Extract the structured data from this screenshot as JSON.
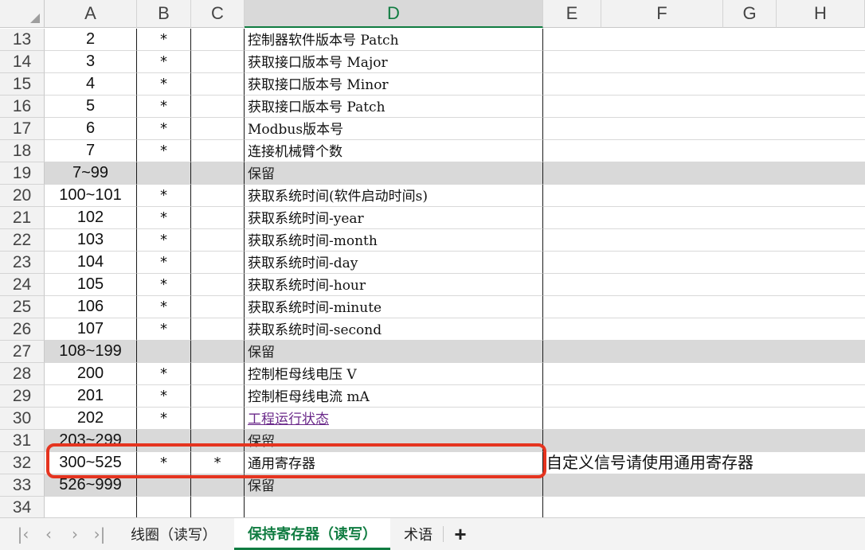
{
  "columns": [
    "A",
    "B",
    "C",
    "D",
    "E",
    "F",
    "G",
    "H"
  ],
  "active_column": "D",
  "rows": [
    {
      "num": "13",
      "a": "2",
      "b": "*",
      "c": "",
      "d": "控制器软件版本号 Patch",
      "e": "",
      "gray": false
    },
    {
      "num": "14",
      "a": "3",
      "b": "*",
      "c": "",
      "d": "获取接口版本号 Major",
      "e": "",
      "gray": false
    },
    {
      "num": "15",
      "a": "4",
      "b": "*",
      "c": "",
      "d": "获取接口版本号 Minor",
      "e": "",
      "gray": false
    },
    {
      "num": "16",
      "a": "5",
      "b": "*",
      "c": "",
      "d": "获取接口版本号 Patch",
      "e": "",
      "gray": false
    },
    {
      "num": "17",
      "a": "6",
      "b": "*",
      "c": "",
      "d": "Modbus版本号",
      "e": "",
      "gray": false
    },
    {
      "num": "18",
      "a": "7",
      "b": "*",
      "c": "",
      "d": "连接机械臂个数",
      "e": "",
      "gray": false
    },
    {
      "num": "19",
      "a": "7~99",
      "b": "",
      "c": "",
      "d": "保留",
      "e": "",
      "gray": true
    },
    {
      "num": "20",
      "a": "100~101",
      "b": "*",
      "c": "",
      "d": "获取系统时间(软件启动时间s)",
      "e": "",
      "gray": false
    },
    {
      "num": "21",
      "a": "102",
      "b": "*",
      "c": "",
      "d": "获取系统时间-year",
      "e": "",
      "gray": false
    },
    {
      "num": "22",
      "a": "103",
      "b": "*",
      "c": "",
      "d": "获取系统时间-month",
      "e": "",
      "gray": false
    },
    {
      "num": "23",
      "a": "104",
      "b": "*",
      "c": "",
      "d": "获取系统时间-day",
      "e": "",
      "gray": false
    },
    {
      "num": "24",
      "a": "105",
      "b": "*",
      "c": "",
      "d": "获取系统时间-hour",
      "e": "",
      "gray": false
    },
    {
      "num": "25",
      "a": "106",
      "b": "*",
      "c": "",
      "d": "获取系统时间-minute",
      "e": "",
      "gray": false
    },
    {
      "num": "26",
      "a": "107",
      "b": "*",
      "c": "",
      "d": "获取系统时间-second",
      "e": "",
      "gray": false
    },
    {
      "num": "27",
      "a": "108~199",
      "b": "",
      "c": "",
      "d": "保留",
      "e": "",
      "gray": true
    },
    {
      "num": "28",
      "a": "200",
      "b": "*",
      "c": "",
      "d": "控制柜母线电压 V",
      "e": "",
      "gray": false
    },
    {
      "num": "29",
      "a": "201",
      "b": "*",
      "c": "",
      "d": "控制柜母线电流 mA",
      "e": "",
      "gray": false
    },
    {
      "num": "30",
      "a": "202",
      "b": "*",
      "c": "",
      "d": "工程运行状态",
      "e": "",
      "gray": false,
      "link": true
    },
    {
      "num": "31",
      "a": "203~299",
      "b": "",
      "c": "",
      "d": "保留",
      "e": "",
      "gray": true
    },
    {
      "num": "32",
      "a": "300~525",
      "b": "*",
      "c": "*",
      "d": "通用寄存器",
      "e": "自定义信号请使用通用寄存器",
      "gray": false
    },
    {
      "num": "33",
      "a": "526~999",
      "b": "",
      "c": "",
      "d": "保留",
      "e": "",
      "gray": true
    },
    {
      "num": "34",
      "a": "",
      "b": "",
      "c": "",
      "d": "",
      "e": "",
      "gray": false
    }
  ],
  "tabs": [
    {
      "label": "线圈（读写）",
      "active": false
    },
    {
      "label": "保持寄存器（读写）",
      "active": true
    },
    {
      "label": "术语",
      "active": false
    }
  ],
  "nav": {
    "first": "|‹",
    "prev": "‹",
    "next": "›",
    "last": "›|"
  },
  "add_sheet_label": "+",
  "colors": {
    "accent": "#107c41",
    "highlight": "#e5341f",
    "reserved_fill": "#d9d9d9",
    "link": "#6b2a8a"
  },
  "icons": [
    "first-sheet-icon",
    "prev-sheet-icon",
    "next-sheet-icon",
    "last-sheet-icon",
    "add-sheet-icon",
    "select-all-icon"
  ]
}
